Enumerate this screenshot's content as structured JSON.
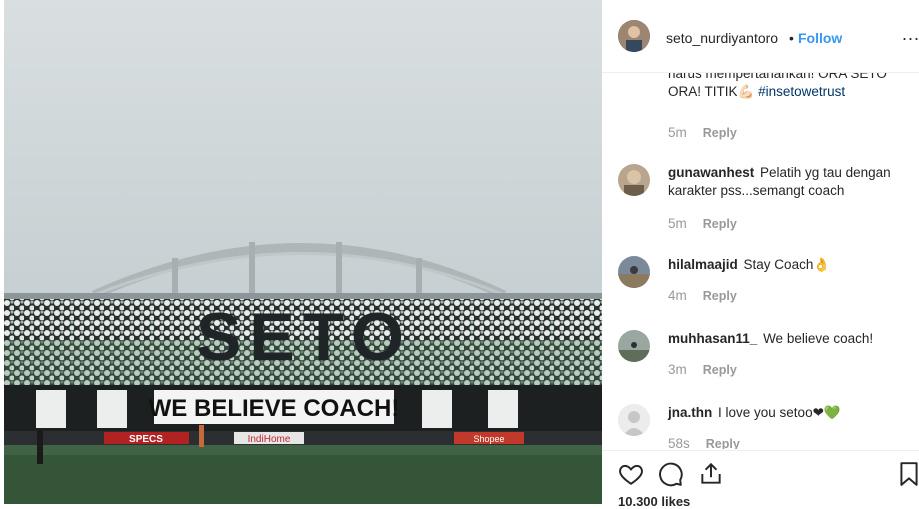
{
  "post": {
    "username": "seto_nurdiyantoro",
    "separator": "•",
    "follow_label": "Follow",
    "more_label": "..."
  },
  "photo": {
    "banner_text": "WE BELIEVE COACH!",
    "choreo_text": "SETO",
    "ad_boards": [
      "SPECS",
      "IndiHome",
      "Shopee"
    ]
  },
  "comments": [
    {
      "user": "",
      "text_before": "harus mempertahankan! ORA SETO ORA! TITIK",
      "emoji": "💪🏻",
      "hashtag": "#insetowetrust",
      "time": "5m",
      "reply": "Reply"
    },
    {
      "user": "gunawanhest",
      "text": "Pelatih yg tau dengan karakter pss...semangt coach",
      "time": "5m",
      "reply": "Reply"
    },
    {
      "user": "hilalmaajid",
      "text": "Stay Coach👌",
      "time": "4m",
      "reply": "Reply"
    },
    {
      "user": "muhhasan11_",
      "text": "We believe coach!",
      "time": "3m",
      "reply": "Reply"
    },
    {
      "user": "jna.thn",
      "text": "I love you setoo❤💚",
      "time": "58s",
      "reply": "Reply"
    }
  ],
  "actions": {
    "like_icon": "heart-icon",
    "comment_icon": "comment-icon",
    "share_icon": "share-icon",
    "save_icon": "bookmark-icon"
  },
  "likes_text": "10.300 likes"
}
